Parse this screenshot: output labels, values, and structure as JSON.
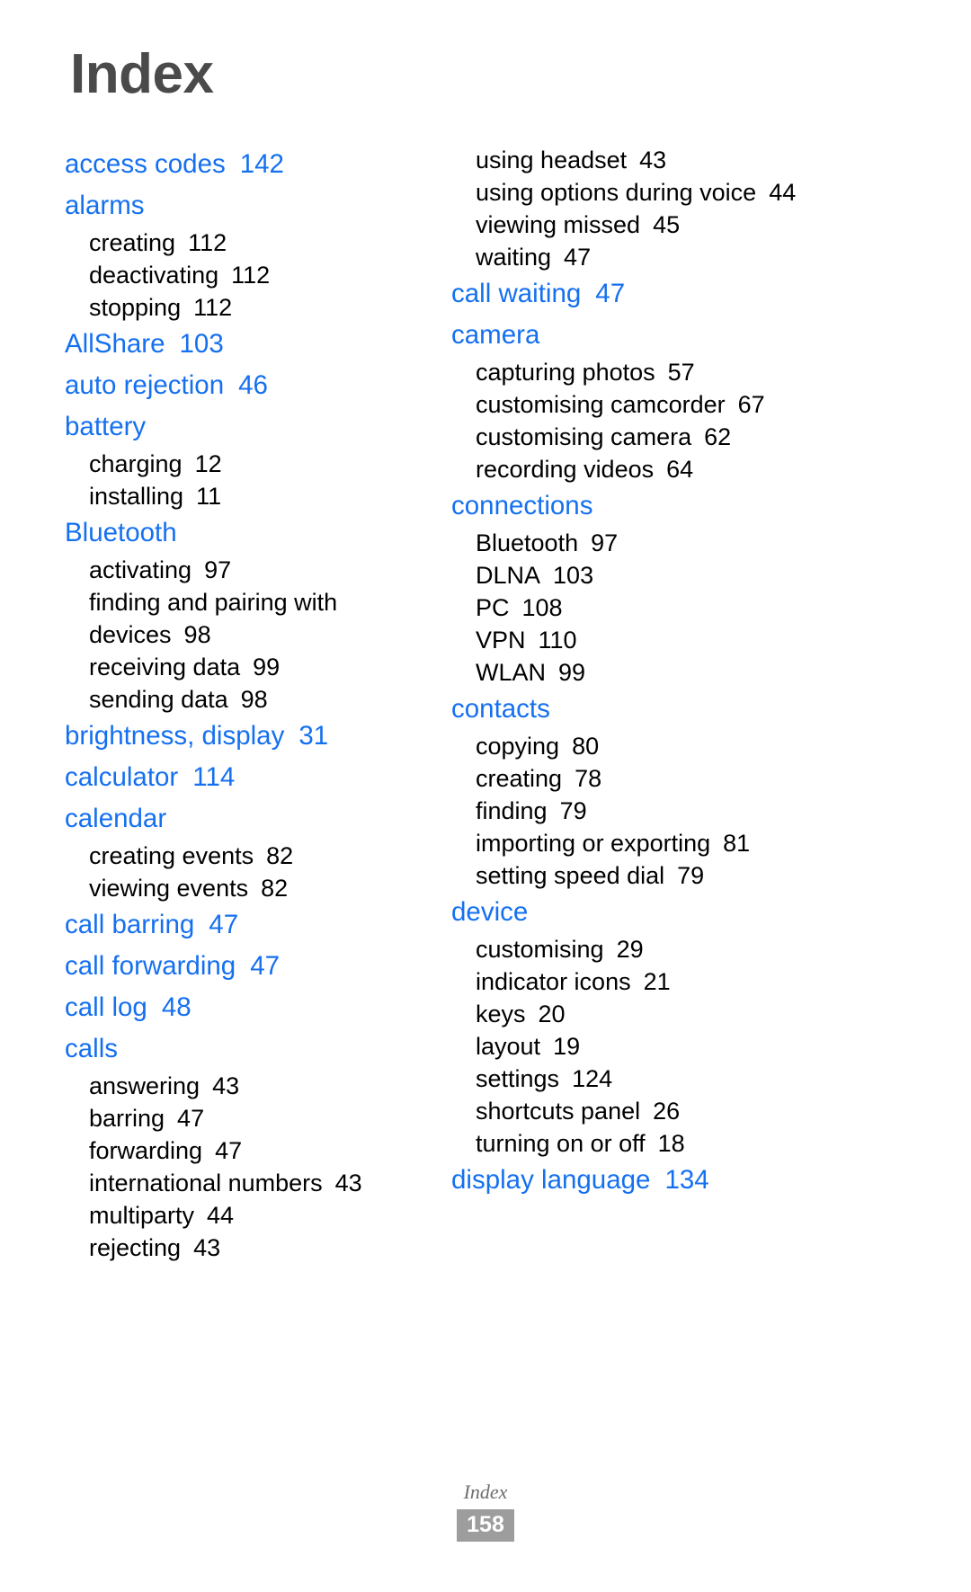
{
  "page": {
    "title": "Index",
    "footer_label": "Index",
    "footer_page_number": "158",
    "heading_color": "#1570f0",
    "title_color": "#4a4a4a",
    "subentry_color": "#000000",
    "page_number_badge_color": "#9d9d9d"
  },
  "columns": [
    {
      "id": "left",
      "entries": [
        {
          "term": "access codes",
          "page": "142",
          "subentries": []
        },
        {
          "term": "alarms",
          "page": "",
          "subentries": [
            {
              "term": "creating",
              "page": "112"
            },
            {
              "term": "deactivating",
              "page": "112"
            },
            {
              "term": "stopping",
              "page": "112"
            }
          ]
        },
        {
          "term": "AllShare",
          "page": "103",
          "subentries": []
        },
        {
          "term": "auto rejection",
          "page": "46",
          "subentries": []
        },
        {
          "term": "battery",
          "page": "",
          "subentries": [
            {
              "term": "charging",
              "page": "12"
            },
            {
              "term": "installing",
              "page": "11"
            }
          ]
        },
        {
          "term": "Bluetooth",
          "page": "",
          "subentries": [
            {
              "term": "activating",
              "page": "97"
            },
            {
              "term": "finding and pairing with devices",
              "page": "98"
            },
            {
              "term": "receiving data",
              "page": "99"
            },
            {
              "term": "sending data",
              "page": "98"
            }
          ]
        },
        {
          "term": "brightness, display",
          "page": "31",
          "subentries": []
        },
        {
          "term": "calculator",
          "page": "114",
          "subentries": []
        },
        {
          "term": "calendar",
          "page": "",
          "subentries": [
            {
              "term": "creating events",
              "page": "82"
            },
            {
              "term": "viewing events",
              "page": "82"
            }
          ]
        },
        {
          "term": "call barring",
          "page": "47",
          "subentries": []
        },
        {
          "term": "call forwarding",
          "page": "47",
          "subentries": []
        },
        {
          "term": "call log",
          "page": "48",
          "subentries": []
        },
        {
          "term": "calls",
          "page": "",
          "subentries": [
            {
              "term": "answering",
              "page": "43"
            },
            {
              "term": "barring",
              "page": "47"
            },
            {
              "term": "forwarding",
              "page": "47"
            },
            {
              "term": "international numbers",
              "page": "43"
            },
            {
              "term": "multiparty",
              "page": "44"
            },
            {
              "term": "rejecting",
              "page": "43"
            }
          ]
        }
      ]
    },
    {
      "id": "right",
      "entries": [
        {
          "term": "",
          "page": "",
          "continued": true,
          "subentries": [
            {
              "term": "using headset",
              "page": "43"
            },
            {
              "term": "using options during voice",
              "page": "44"
            },
            {
              "term": "viewing missed",
              "page": "45"
            },
            {
              "term": "waiting",
              "page": "47"
            }
          ]
        },
        {
          "term": "call waiting",
          "page": "47",
          "subentries": []
        },
        {
          "term": "camera",
          "page": "",
          "subentries": [
            {
              "term": "capturing photos",
              "page": "57"
            },
            {
              "term": "customising camcorder",
              "page": "67"
            },
            {
              "term": "customising camera",
              "page": "62"
            },
            {
              "term": "recording videos",
              "page": "64"
            }
          ]
        },
        {
          "term": "connections",
          "page": "",
          "subentries": [
            {
              "term": "Bluetooth",
              "page": "97"
            },
            {
              "term": "DLNA",
              "page": "103"
            },
            {
              "term": "PC",
              "page": "108"
            },
            {
              "term": "VPN",
              "page": "110"
            },
            {
              "term": "WLAN",
              "page": "99"
            }
          ]
        },
        {
          "term": "contacts",
          "page": "",
          "subentries": [
            {
              "term": "copying",
              "page": "80"
            },
            {
              "term": "creating",
              "page": "78"
            },
            {
              "term": "finding",
              "page": "79"
            },
            {
              "term": "importing or exporting",
              "page": "81"
            },
            {
              "term": "setting speed dial",
              "page": "79"
            }
          ]
        },
        {
          "term": "device",
          "page": "",
          "subentries": [
            {
              "term": "customising",
              "page": "29"
            },
            {
              "term": "indicator icons",
              "page": "21"
            },
            {
              "term": "keys",
              "page": "20"
            },
            {
              "term": "layout",
              "page": "19"
            },
            {
              "term": "settings",
              "page": "124"
            },
            {
              "term": "shortcuts panel",
              "page": "26"
            },
            {
              "term": "turning on or off",
              "page": "18"
            }
          ]
        },
        {
          "term": "display language",
          "page": "134",
          "subentries": []
        }
      ]
    }
  ]
}
